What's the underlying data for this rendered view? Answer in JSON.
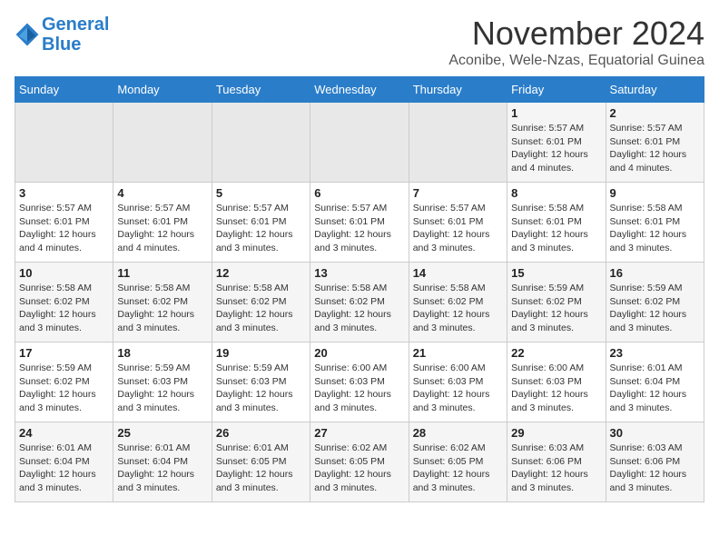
{
  "logo": {
    "line1": "General",
    "line2": "Blue"
  },
  "title": "November 2024",
  "subtitle": "Aconibe, Wele-Nzas, Equatorial Guinea",
  "weekdays": [
    "Sunday",
    "Monday",
    "Tuesday",
    "Wednesday",
    "Thursday",
    "Friday",
    "Saturday"
  ],
  "weeks": [
    [
      {
        "day": "",
        "info": ""
      },
      {
        "day": "",
        "info": ""
      },
      {
        "day": "",
        "info": ""
      },
      {
        "day": "",
        "info": ""
      },
      {
        "day": "",
        "info": ""
      },
      {
        "day": "1",
        "info": "Sunrise: 5:57 AM\nSunset: 6:01 PM\nDaylight: 12 hours\nand 4 minutes."
      },
      {
        "day": "2",
        "info": "Sunrise: 5:57 AM\nSunset: 6:01 PM\nDaylight: 12 hours\nand 4 minutes."
      }
    ],
    [
      {
        "day": "3",
        "info": "Sunrise: 5:57 AM\nSunset: 6:01 PM\nDaylight: 12 hours\nand 4 minutes."
      },
      {
        "day": "4",
        "info": "Sunrise: 5:57 AM\nSunset: 6:01 PM\nDaylight: 12 hours\nand 4 minutes."
      },
      {
        "day": "5",
        "info": "Sunrise: 5:57 AM\nSunset: 6:01 PM\nDaylight: 12 hours\nand 3 minutes."
      },
      {
        "day": "6",
        "info": "Sunrise: 5:57 AM\nSunset: 6:01 PM\nDaylight: 12 hours\nand 3 minutes."
      },
      {
        "day": "7",
        "info": "Sunrise: 5:57 AM\nSunset: 6:01 PM\nDaylight: 12 hours\nand 3 minutes."
      },
      {
        "day": "8",
        "info": "Sunrise: 5:58 AM\nSunset: 6:01 PM\nDaylight: 12 hours\nand 3 minutes."
      },
      {
        "day": "9",
        "info": "Sunrise: 5:58 AM\nSunset: 6:01 PM\nDaylight: 12 hours\nand 3 minutes."
      }
    ],
    [
      {
        "day": "10",
        "info": "Sunrise: 5:58 AM\nSunset: 6:02 PM\nDaylight: 12 hours\nand 3 minutes."
      },
      {
        "day": "11",
        "info": "Sunrise: 5:58 AM\nSunset: 6:02 PM\nDaylight: 12 hours\nand 3 minutes."
      },
      {
        "day": "12",
        "info": "Sunrise: 5:58 AM\nSunset: 6:02 PM\nDaylight: 12 hours\nand 3 minutes."
      },
      {
        "day": "13",
        "info": "Sunrise: 5:58 AM\nSunset: 6:02 PM\nDaylight: 12 hours\nand 3 minutes."
      },
      {
        "day": "14",
        "info": "Sunrise: 5:58 AM\nSunset: 6:02 PM\nDaylight: 12 hours\nand 3 minutes."
      },
      {
        "day": "15",
        "info": "Sunrise: 5:59 AM\nSunset: 6:02 PM\nDaylight: 12 hours\nand 3 minutes."
      },
      {
        "day": "16",
        "info": "Sunrise: 5:59 AM\nSunset: 6:02 PM\nDaylight: 12 hours\nand 3 minutes."
      }
    ],
    [
      {
        "day": "17",
        "info": "Sunrise: 5:59 AM\nSunset: 6:02 PM\nDaylight: 12 hours\nand 3 minutes."
      },
      {
        "day": "18",
        "info": "Sunrise: 5:59 AM\nSunset: 6:03 PM\nDaylight: 12 hours\nand 3 minutes."
      },
      {
        "day": "19",
        "info": "Sunrise: 5:59 AM\nSunset: 6:03 PM\nDaylight: 12 hours\nand 3 minutes."
      },
      {
        "day": "20",
        "info": "Sunrise: 6:00 AM\nSunset: 6:03 PM\nDaylight: 12 hours\nand 3 minutes."
      },
      {
        "day": "21",
        "info": "Sunrise: 6:00 AM\nSunset: 6:03 PM\nDaylight: 12 hours\nand 3 minutes."
      },
      {
        "day": "22",
        "info": "Sunrise: 6:00 AM\nSunset: 6:03 PM\nDaylight: 12 hours\nand 3 minutes."
      },
      {
        "day": "23",
        "info": "Sunrise: 6:01 AM\nSunset: 6:04 PM\nDaylight: 12 hours\nand 3 minutes."
      }
    ],
    [
      {
        "day": "24",
        "info": "Sunrise: 6:01 AM\nSunset: 6:04 PM\nDaylight: 12 hours\nand 3 minutes."
      },
      {
        "day": "25",
        "info": "Sunrise: 6:01 AM\nSunset: 6:04 PM\nDaylight: 12 hours\nand 3 minutes."
      },
      {
        "day": "26",
        "info": "Sunrise: 6:01 AM\nSunset: 6:05 PM\nDaylight: 12 hours\nand 3 minutes."
      },
      {
        "day": "27",
        "info": "Sunrise: 6:02 AM\nSunset: 6:05 PM\nDaylight: 12 hours\nand 3 minutes."
      },
      {
        "day": "28",
        "info": "Sunrise: 6:02 AM\nSunset: 6:05 PM\nDaylight: 12 hours\nand 3 minutes."
      },
      {
        "day": "29",
        "info": "Sunrise: 6:03 AM\nSunset: 6:06 PM\nDaylight: 12 hours\nand 3 minutes."
      },
      {
        "day": "30",
        "info": "Sunrise: 6:03 AM\nSunset: 6:06 PM\nDaylight: 12 hours\nand 3 minutes."
      }
    ]
  ]
}
